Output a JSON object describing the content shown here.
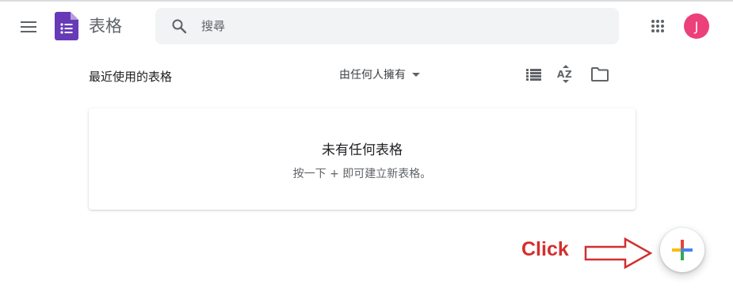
{
  "header": {
    "app_title": "表格",
    "search_placeholder": "搜尋",
    "avatar_initial": "J",
    "avatar_color": "#ec407a",
    "logo_color": "#673ab7"
  },
  "toolbar": {
    "section_title": "最近使用的表格",
    "owner_filter": "由任何人擁有",
    "icons": [
      "list-view-icon",
      "sort-az-icon",
      "folder-icon"
    ]
  },
  "empty_state": {
    "title": "未有任何表格",
    "subtitle": "按一下 + 即可建立新表格。"
  },
  "annotation": {
    "label": "Click",
    "color": "#d32f2f"
  },
  "fab": {
    "icon": "multicolor-plus-icon",
    "colors": [
      "#ea4335",
      "#fbbc04",
      "#34a853",
      "#4285f4"
    ]
  }
}
